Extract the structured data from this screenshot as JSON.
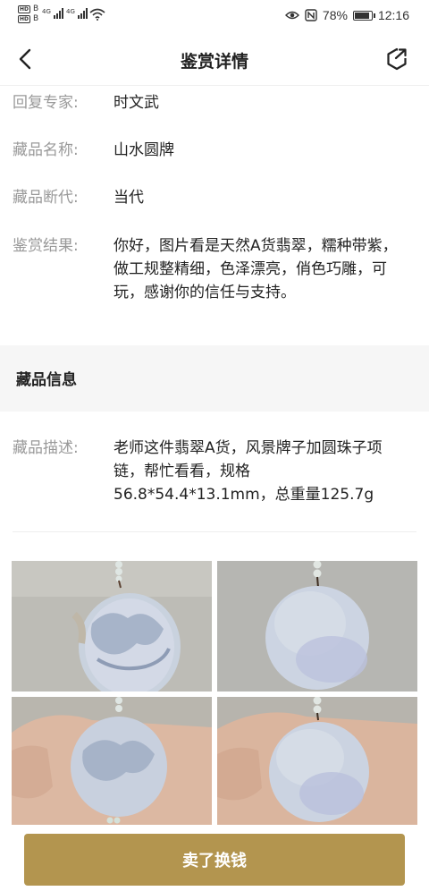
{
  "status_bar": {
    "hd_label": "HD",
    "sim1_suffix": "B",
    "sim2_suffix": "B",
    "network1": "4G",
    "network2": "4G",
    "battery_percent": "78%",
    "battery_level": 0.78,
    "time": "12:16"
  },
  "header": {
    "title": "鉴赏详情"
  },
  "appraisal": {
    "expert_label": "回复专家:",
    "expert_value": "时文武",
    "name_label": "藏品名称:",
    "name_value": "山水圆牌",
    "era_label": "藏品断代:",
    "era_value": "当代",
    "result_label": "鉴赏结果:",
    "result_value": "你好，图片看是天然A货翡翠，糯种带紫，做工规整精细，色泽漂亮，俏色巧雕，可玩，感谢你的信任与支持。"
  },
  "collection_info": {
    "section_title": "藏品信息",
    "description_label": "藏品描述:",
    "description_value": "老师这件翡翠A货，风景牌子加圆珠子项链，帮忙看看，规格56.8*54.4*13.1mm，总重量125.7g"
  },
  "photos": [
    {
      "kind": "carved-front"
    },
    {
      "kind": "plain-back"
    },
    {
      "kind": "carved-in-hand"
    },
    {
      "kind": "plain-in-hand"
    }
  ],
  "bottom": {
    "sell_label": "卖了换钱"
  },
  "colors": {
    "accent": "#b3954f",
    "label_gray": "#999999",
    "section_bg": "#f6f6f6"
  }
}
